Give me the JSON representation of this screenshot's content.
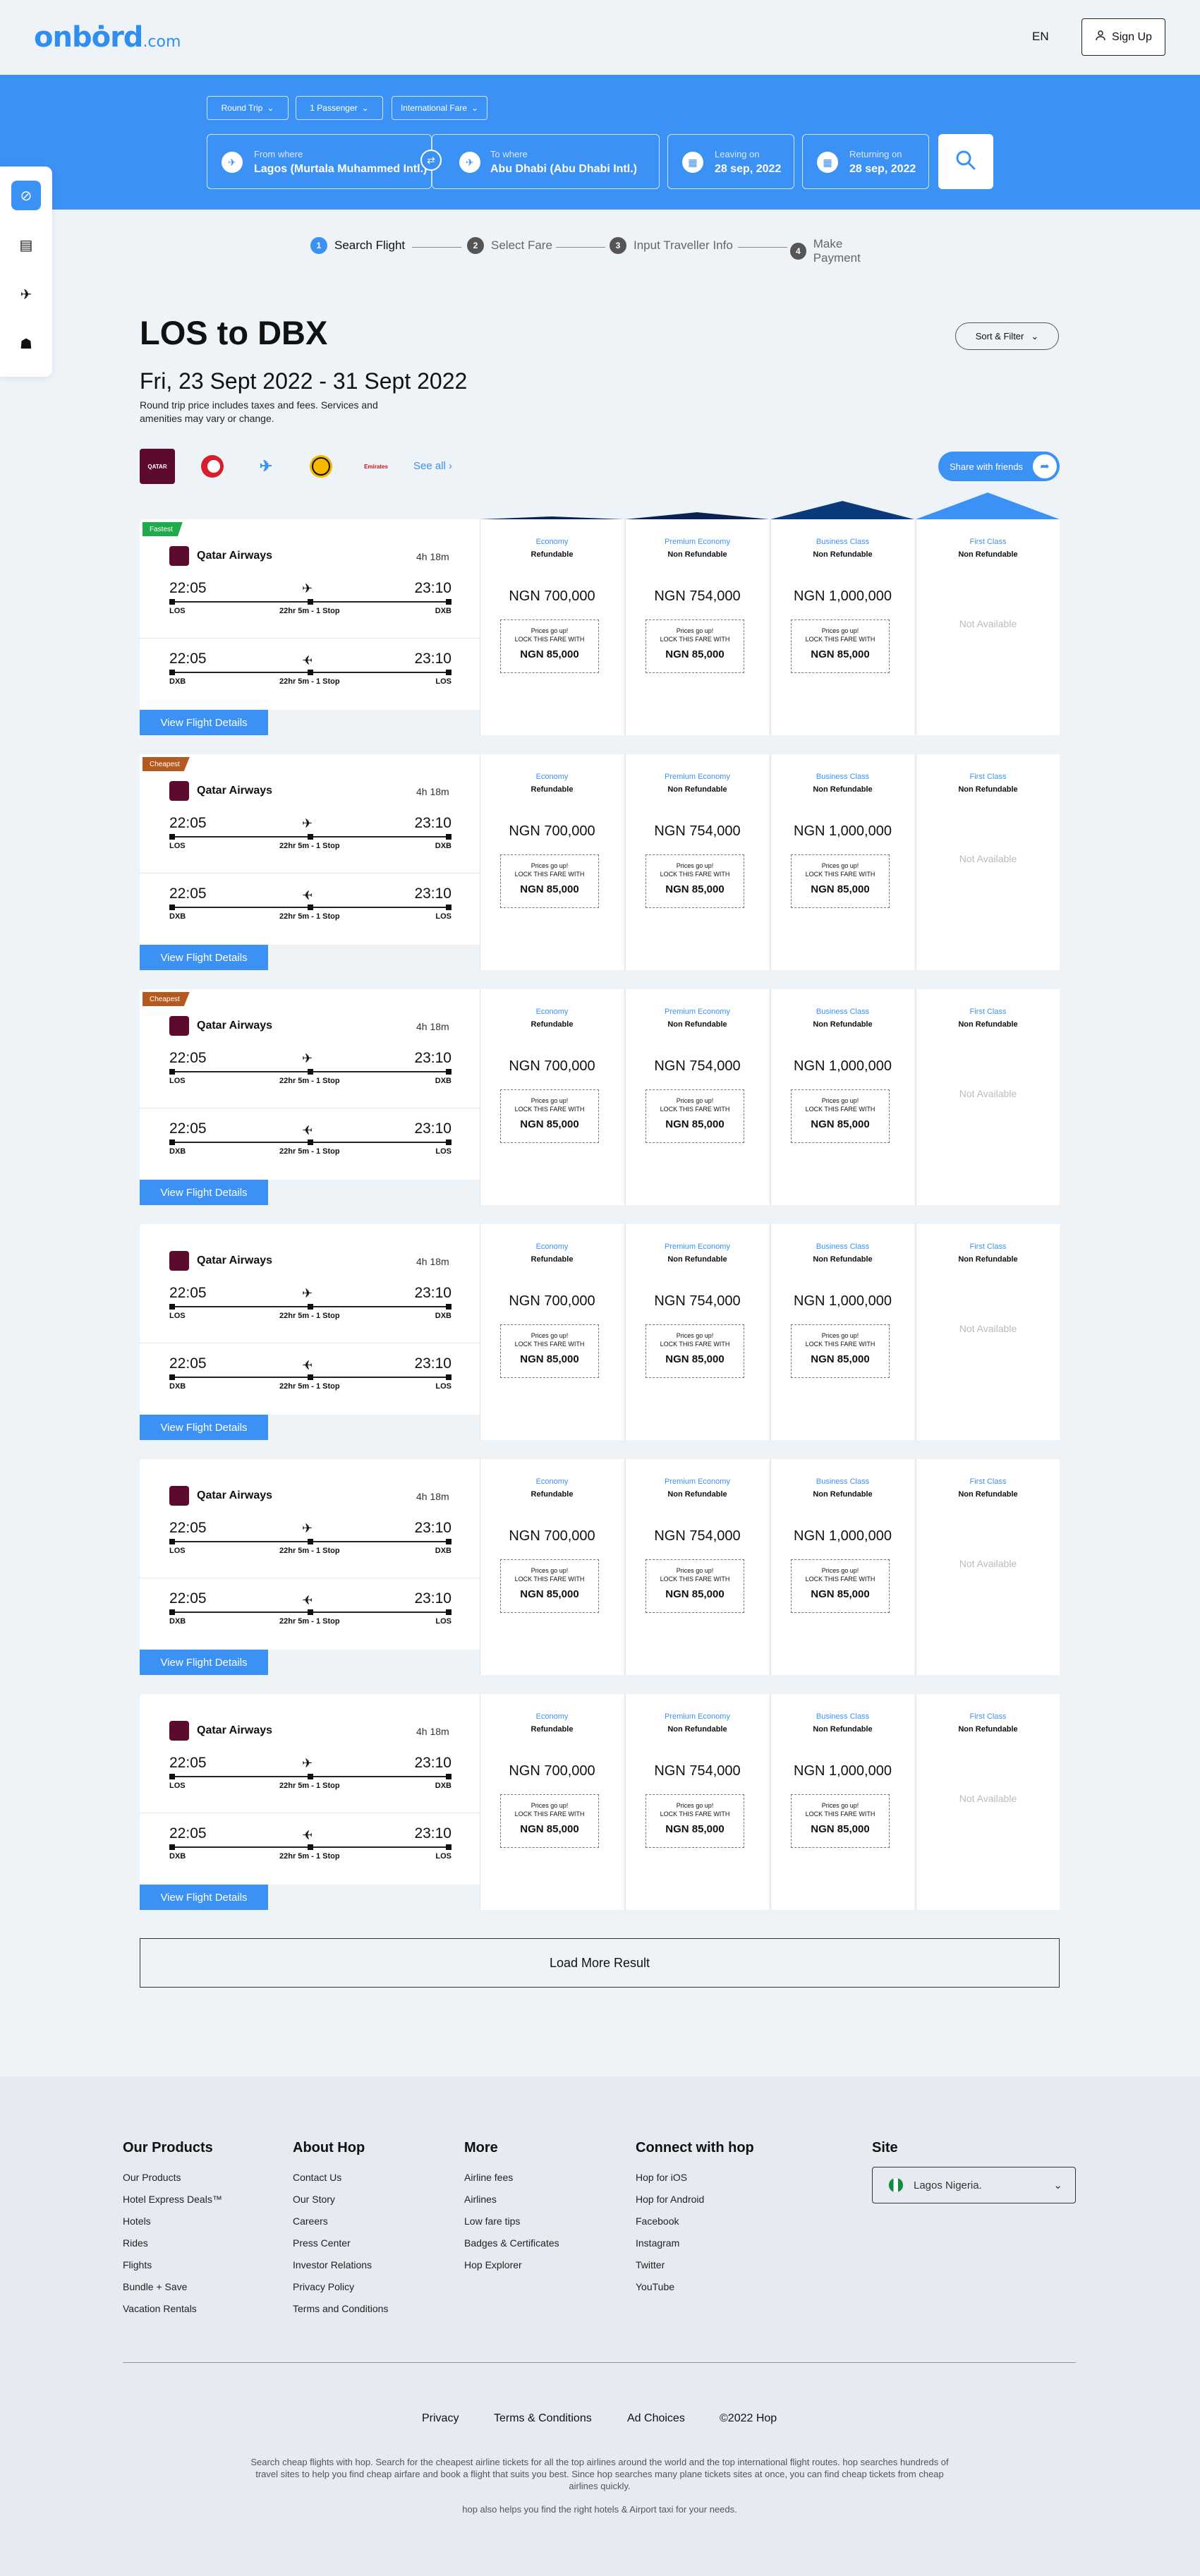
{
  "header": {
    "logo_main": "onbȯrd",
    "logo_domain": ".com",
    "language": "EN",
    "signup_label": "Sign Up"
  },
  "search": {
    "trip_type": "Round Trip",
    "passengers": "1 Passenger",
    "fare_type": "International Fare",
    "from_label": "From where",
    "from_value": "Lagos (Murtala Muhammed Intl.)",
    "to_label": "To where",
    "to_value": "Abu Dhabi (Abu Dhabi Intl.)",
    "leaving_label": "Leaving on",
    "leaving_value": "28 sep, 2022",
    "returning_label": "Returning on",
    "returning_value": "28 sep, 2022"
  },
  "steps": [
    {
      "num": "1",
      "label": "Search Flight"
    },
    {
      "num": "2",
      "label": "Select Fare"
    },
    {
      "num": "3",
      "label": "Input Traveller Info"
    },
    {
      "num": "4",
      "label": "Make Payment"
    }
  ],
  "results": {
    "route": "LOS to DBX",
    "dates": "Fri, 23 Sept 2022 - 31 Sept 2022",
    "note": "Round trip price includes taxes and fees. Services and amenities may vary or change.",
    "sort_label": "Sort & Filter",
    "see_all": "See all",
    "share_label": "Share with friends",
    "airline_logos": [
      "QATAR",
      "",
      "",
      "",
      "Emirates"
    ],
    "load_more": "Load More Result"
  },
  "fare_classes": [
    {
      "name": "Economy",
      "refund": "Refundable",
      "price": "NGN 700,000",
      "available": true
    },
    {
      "name": "Premium Economy",
      "refund": "Non Refundable",
      "price": "NGN 754,000",
      "available": true
    },
    {
      "name": "Business Class",
      "refund": "Non Refundable",
      "price": "NGN 1,000,000",
      "available": true
    },
    {
      "name": "First Class",
      "refund": "Non Refundable",
      "price": "",
      "available": false
    }
  ],
  "lock": {
    "line1": "Prices go up!",
    "line2": "LOCK THIS FARE WITH",
    "amount": "NGN 85,000",
    "not_available": "Not Available"
  },
  "flights": [
    {
      "badge": "Fastest",
      "badge_color": "#1faa4b"
    },
    {
      "badge": "Cheapest",
      "badge_color": "#b55a1e"
    },
    {
      "badge": "Cheapest",
      "badge_color": "#b55a1e"
    },
    {
      "badge": "",
      "badge_color": ""
    },
    {
      "badge": "",
      "badge_color": ""
    },
    {
      "badge": "",
      "badge_color": ""
    }
  ],
  "flight_common": {
    "airline": "Qatar Airways",
    "duration": "4h 18m",
    "out_dep": "22:05",
    "out_arr": "23:10",
    "out_from": "LOS",
    "out_to": "DXB",
    "ret_dep": "22:05",
    "ret_arr": "23:10",
    "ret_from": "DXB",
    "ret_to": "LOS",
    "stops": "22hr 5m - 1 Stop",
    "details_label": "View Flight Details"
  },
  "footer": {
    "columns": [
      {
        "title": "Our Products",
        "items": [
          "Our Products",
          "Hotel Express Deals™",
          "Hotels",
          "Rides",
          "Flights",
          "Bundle + Save",
          "Vacation Rentals"
        ]
      },
      {
        "title": "About Hop",
        "items": [
          "Contact Us",
          "Our Story",
          "Careers",
          "Press Center",
          "Investor Relations",
          "Privacy Policy",
          "Terms and Conditions"
        ]
      },
      {
        "title": "More",
        "items": [
          "Airline fees",
          "Airlines",
          "Low fare tips",
          "Badges & Certificates",
          "Hop Explorer"
        ]
      },
      {
        "title": "Connect with hop",
        "items": [
          "Hop for iOS",
          "Hop for Android",
          "Facebook",
          "Instagram",
          "Twitter",
          "YouTube"
        ]
      }
    ],
    "site_title": "Site",
    "site_value": "Lagos Nigeria.",
    "bottom_links": [
      "Privacy",
      "Terms & Conditions",
      "Ad Choices",
      "©2022 Hop"
    ],
    "about_text": "Search cheap flights with hop. Search for the cheapest airline tickets for all the top airlines around the world and the top international flight routes. hop searches hundreds of travel sites to help you find cheap airfare and book a flight that suits you best. Since hop searches many plane tickets sites at once, you can find cheap tickets from cheap airlines quickly.",
    "about_text2": "hop also helps you find the right hotels & Airport taxi for your needs."
  },
  "colors": {
    "brand": "#3c91f5",
    "fastest": "#1faa4b",
    "cheapest": "#b55a1e",
    "dark_tab": "#0b2250"
  }
}
